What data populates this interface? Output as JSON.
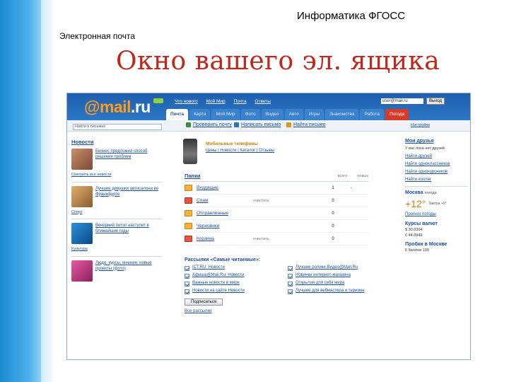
{
  "slide": {
    "course_title": "Информатика ФГОСС",
    "section_title": "Электронная почта",
    "heading": "Окно вашего  эл. ящика"
  },
  "mail": {
    "logo_at": "@",
    "logo_name": "mail",
    "logo_domain": ".ru",
    "top_links": [
      "Что нового",
      "Мой Мир",
      "Почта",
      "Ответы"
    ],
    "login_value": "user@mail.ru",
    "login_button": "Выход",
    "tabs": [
      "Почта",
      "Карта",
      "Мой Мир",
      "Фото",
      "Видео",
      "Авто",
      "Игры",
      "Знакомства",
      "Работа",
      "Погода"
    ],
    "active_tab": "Почта",
    "search_value": "Найти в письмах",
    "actions": [
      "Проверить почту",
      "Написать письмо",
      "Найти письмо"
    ],
    "options_link": "Настройки"
  },
  "news": {
    "title": "Новости",
    "items": [
      {
        "text": "Бизнес предложил способ решения проблем"
      },
      {
        "text": "Лучшие девушки автосалона во Франкфурте"
      },
      {
        "text": "Вечерний потоп наступит в ближайшие годы"
      },
      {
        "text": "Люди, курсы, мнения: новые проекты (фото)"
      }
    ],
    "bullets": [
      "Смотреть все новости",
      "Спорт",
      "Культура"
    ]
  },
  "promo": {
    "title": "Мобильные телефоны",
    "sub": "Цены | Новости | Каталог | Отзывы"
  },
  "folders": {
    "title": "Папки",
    "col_total": "всего",
    "col_new": "новых",
    "rows": [
      {
        "name": "Входящие",
        "extra": "",
        "count": "1",
        "unread": "-"
      },
      {
        "name": "Спам",
        "extra": "очистить",
        "count": "0",
        "unread": ""
      },
      {
        "name": "Отправленные",
        "extra": "",
        "count": "0",
        "unread": ""
      },
      {
        "name": "Черновики",
        "extra": "",
        "count": "0",
        "unread": ""
      },
      {
        "name": "Корзина",
        "extra": "очистить",
        "count": "0",
        "unread": ""
      }
    ]
  },
  "subscriptions": {
    "title": "Рассылки «Самые читаемые»:",
    "items": [
      "ICT.RU: Новости",
      "Лучшие ролики Видео@Mail.Ru",
      "Афиша@Mail.Ru: Новости",
      "Новинки интернет-магазина",
      "Важные новости в мире",
      "Открытия для себя мира",
      "Новости на сайте Новости",
      "Лучшее для вебмастера и туризма"
    ],
    "button": "Подписаться",
    "all_link": "Все рассылки"
  },
  "right": {
    "friends_title": "Мои друзья",
    "friends_line": "У вас пока нет друзей",
    "find_friends": "Найти друзей",
    "links": [
      "Найти одноклассников",
      "Найти однокурсников",
      "Найти коллег"
    ],
    "city_title": "Москва",
    "city_note": "погода",
    "temperature": "+12°",
    "weather_note": "Завтра +9°",
    "forecast_link": "Прогноз погоды",
    "rates_title": "Курсы валют",
    "rates": [
      "$ 30.0304",
      "€ 44.0949"
    ],
    "events_title": "Пробки в Москве",
    "events_line": "6 баллов 100"
  }
}
